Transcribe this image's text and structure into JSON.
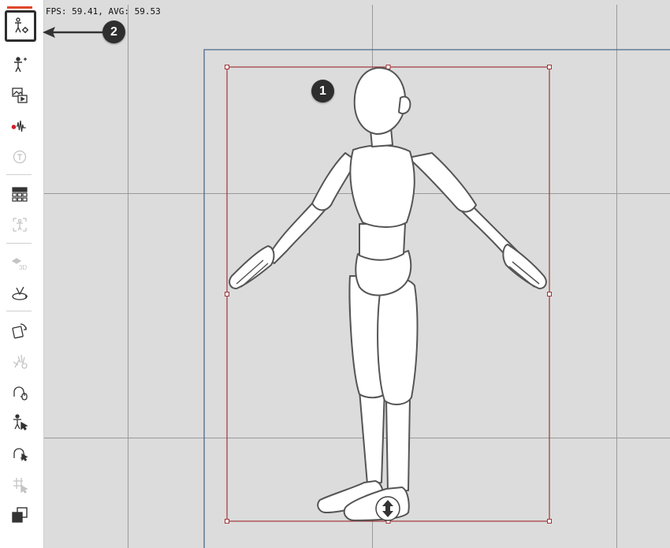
{
  "status": {
    "fps_text": "FPS: 59.41, AVG: 59.53"
  },
  "callouts": {
    "model": "1",
    "toolbar_button": "2"
  },
  "colors": {
    "accent": "#e0472a",
    "bounding_box": "#a0343a",
    "camera_frame": "#4a6a8a"
  },
  "toolbar": {
    "items": [
      {
        "icon": "figure-settings-icon",
        "selected": true
      },
      {
        "icon": "figure-sparkle-icon"
      },
      {
        "icon": "image-play-icon"
      },
      {
        "icon": "audio-record-icon"
      },
      {
        "icon": "text-circle-icon",
        "disabled": true
      },
      {
        "icon": "grid-table-icon"
      },
      {
        "icon": "pose-frame-icon",
        "disabled": true
      },
      {
        "icon": "layer-3d-icon",
        "disabled": true
      },
      {
        "icon": "camera-orbit-icon"
      },
      {
        "icon": "rotate-object-icon"
      },
      {
        "icon": "hand-pose-icon",
        "disabled": true
      },
      {
        "icon": "head-mouse-icon"
      },
      {
        "icon": "figure-cursor-icon"
      },
      {
        "icon": "face-cursor-icon"
      },
      {
        "icon": "grid-select-icon",
        "disabled": true
      },
      {
        "icon": "copy-layer-icon"
      }
    ]
  }
}
